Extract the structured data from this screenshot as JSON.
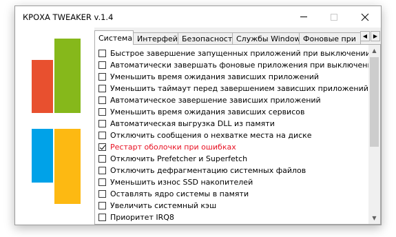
{
  "window": {
    "title": "КРОХА TWEAKER v.1.4",
    "min_glyph": "",
    "close_glyph": ""
  },
  "tabs": [
    {
      "label": "Система",
      "active": true
    },
    {
      "label": "Интерфейс",
      "active": false
    },
    {
      "label": "Безопасность",
      "active": false
    },
    {
      "label": "Службы Windows",
      "active": false
    },
    {
      "label": "Фоновые при",
      "active": false
    }
  ],
  "tab_nav": {
    "left": "◀",
    "right": "▶"
  },
  "scrollbar": {
    "up": "▲",
    "down": "▼",
    "position": 0.0
  },
  "options": [
    {
      "label": "Быстрое завершение запущенных приложений при выключении ПК",
      "checked": false,
      "highlight": false
    },
    {
      "label": "Автоматически завершать фоновые приложения при выключении ПК",
      "checked": false,
      "highlight": false
    },
    {
      "label": "Уменьшить время ожидания зависших приложений",
      "checked": false,
      "highlight": false
    },
    {
      "label": "Уменьшить таймаут перед завершением зависших приложений",
      "checked": false,
      "highlight": false
    },
    {
      "label": "Автоматическое завершение зависших приложений",
      "checked": false,
      "highlight": false
    },
    {
      "label": "Уменьшить время ожидания зависших сервисов",
      "checked": false,
      "highlight": false
    },
    {
      "label": "Автоматическая выгрузка DLL из памяти",
      "checked": false,
      "highlight": false
    },
    {
      "label": "Отключить сообщения о нехватке места на диске",
      "checked": false,
      "highlight": false
    },
    {
      "label": "Рестарт оболочки при ошибках",
      "checked": true,
      "highlight": true
    },
    {
      "label": "Отключить Prefetcher и Superfetch",
      "checked": false,
      "highlight": false
    },
    {
      "label": "Отключить дефрагментацию системных файлов",
      "checked": false,
      "highlight": false
    },
    {
      "label": "Уменьшить износ SSD накопителей",
      "checked": false,
      "highlight": false
    },
    {
      "label": "Оставлять ядро системы в памяти",
      "checked": false,
      "highlight": false
    },
    {
      "label": "Увеличить системный кэш",
      "checked": false,
      "highlight": false
    },
    {
      "label": "Приоритет IRQ8",
      "checked": false,
      "highlight": false
    }
  ],
  "colors": {
    "logo_red": "#e8502f",
    "logo_green": "#86b81b",
    "logo_blue": "#00a2e8",
    "logo_yellow": "#fdb912",
    "highlight_text": "#e81123"
  }
}
